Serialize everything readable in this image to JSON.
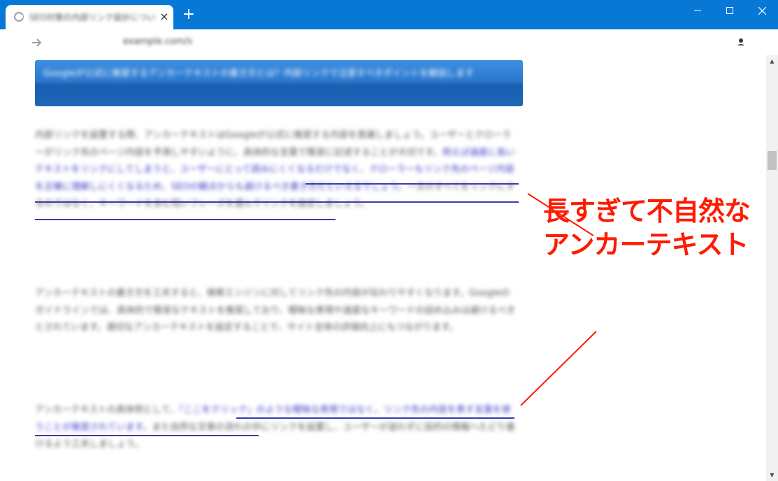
{
  "browser": {
    "tab_title": "SEO対策の内部リンク設計について解説",
    "tab_close": "×",
    "new_tab": "+",
    "url": "example.com/seo",
    "colors": {
      "titlebar": "#0878d7",
      "annotation": "#ff1a00",
      "link_underline": "#3b3bb0"
    }
  },
  "icons": [
    "tab-favicon-icon",
    "close-icon",
    "plus-icon",
    "minimize-icon",
    "maximize-icon",
    "window-close-icon",
    "back-arrow-icon",
    "forward-arrow-icon",
    "reload-icon",
    "home-icon",
    "lock-icon",
    "star-icon",
    "account-icon",
    "menu-dots-icon"
  ],
  "article": {
    "heading": "Googleが公式に推奨するアンカーテキストの書き方とは？内部リンクで注意すべきポイントを解説します",
    "para1_before": "内部リンクを設置する際、アンカーテキストはGoogleが公式に推奨する内容を意識しましょう。ユーザーとクローラーがリンク先のページ内容を予測しやすいように、具体的な言葉で簡潔に記述することが大切です。",
    "para1_link": "例えば過度に長いテキストをリンクにしてしまうと、ユーザーにとって読みにくくなるだけでなく、クローラーもリンク先のページ内容を正確に理解しにくくなるため、SEOの観点からも避けるべき書き方だといえるでしょう。",
    "para1_after": "一文のすべてをリンクにするのではなく、キーワードを含む短いフレーズを選んでリンクを設定しましょう。",
    "para2": "アンカーテキストの書き方を工夫すると、検索エンジンに対してリンク先の内容が伝わりやすくなります。Googleのガイドラインでは、具体的で簡潔なテキストを推奨しており、曖昧な表現や過度なキーワードの詰め込みは避けるべきとされています。適切なアンカーテキストを設定することで、サイト全体の評価向上にもつながります。",
    "para3_before": "アンカーテキストの具体例として、",
    "para3_link": "「ここをクリック」のような曖昧な表現ではなく、リンク先の内容を表す言葉を使うことが推奨されています。",
    "para3_after": "また自然な文章の流れの中にリンクを設置し、ユーザーが迷わずに目的の情報へたどり着けるよう工夫しましょう。"
  },
  "annotation": {
    "line1": "長すぎて不自然な",
    "line2": "アンカーテキスト"
  }
}
